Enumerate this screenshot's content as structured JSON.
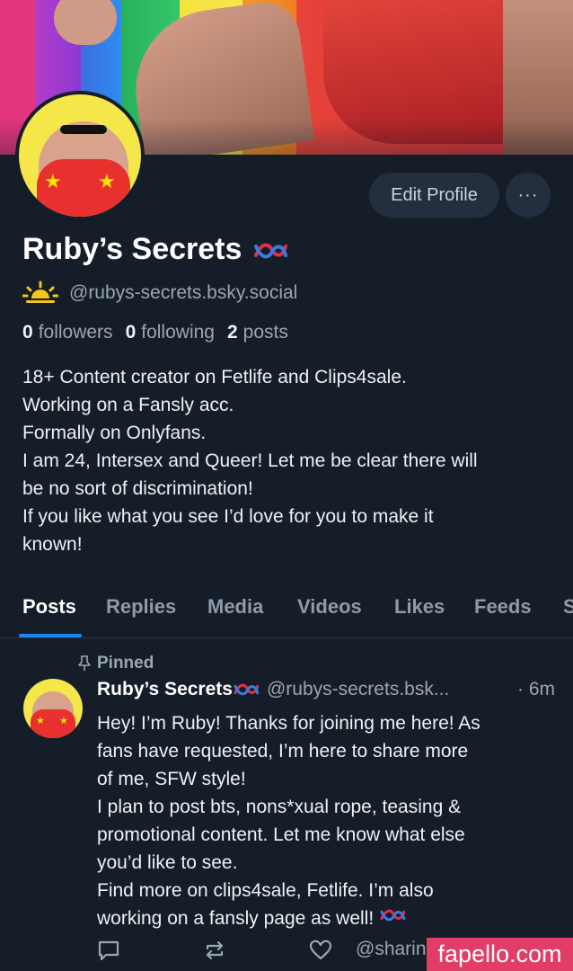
{
  "profile": {
    "display_name": "Ruby’s Secrets",
    "handle": "@rubys-secrets.bsky.social",
    "followers_count": "0",
    "followers_label": "followers",
    "following_count": "0",
    "following_label": "following",
    "posts_count": "2",
    "posts_label": "posts",
    "bio_lines": [
      "18+ Content creator on Fetlife and Clips4sale.",
      "Working on a Fansly acc.",
      "Formally on Onlyfans.",
      "I am 24, Intersex and Queer! Let me be clear there will",
      "be no sort of discrimination!",
      "If you like what you see I’d love for you to make it",
      "known!"
    ]
  },
  "actions": {
    "edit_profile_label": "Edit Profile",
    "more_label": "···"
  },
  "tabs": [
    {
      "label": "Posts",
      "active": true
    },
    {
      "label": "Replies"
    },
    {
      "label": "Media"
    },
    {
      "label": "Videos"
    },
    {
      "label": "Likes"
    },
    {
      "label": "Feeds"
    },
    {
      "label": "S"
    }
  ],
  "post": {
    "pinned_label": "Pinned",
    "author_name": "Ruby’s Secrets",
    "author_handle": "@rubys-secrets.bsk...",
    "time": "· 6m",
    "lines": [
      "Hey! I’m Ruby! Thanks for joining me here! As",
      "fans have requested, I’m here to share more",
      "of me, SFW style!",
      "I plan to post bts, nons*xual rope, teasing &",
      "promotional content. Let me know what else",
      "you’d like to see.",
      "Find more on clips4sale, Fetlife. I’m also",
      "working on a fansly page as well!"
    ],
    "share_text": "@sharin"
  },
  "watermark": "fapello.com",
  "colors": {
    "background": "#151d28",
    "accent": "#1c86f2",
    "muted_text": "#9aa6b4",
    "button_bg": "#232f3e",
    "watermark_bg": "#e23d67"
  },
  "icons": [
    "sun-icon",
    "rope-emoji-icon",
    "pin-icon",
    "reply-icon",
    "repost-icon",
    "like-icon"
  ]
}
